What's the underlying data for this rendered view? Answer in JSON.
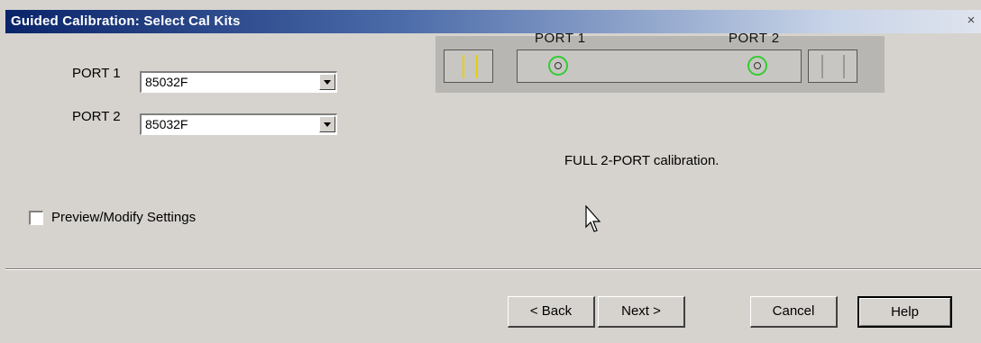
{
  "window": {
    "title": "Guided Calibration: Select Cal Kits",
    "close_glyph": "×"
  },
  "ports": [
    {
      "label": "PORT 1",
      "value": "85032F"
    },
    {
      "label": "PORT 2",
      "value": "85032F"
    }
  ],
  "diagram": {
    "port1_label": "PORT 1",
    "port2_label": "PORT 2"
  },
  "status": {
    "text": "FULL 2-PORT calibration."
  },
  "options": {
    "preview_label": "Preview/Modify Settings",
    "preview_checked": false
  },
  "buttons": {
    "back": "< Back",
    "next": "Next >",
    "cancel": "Cancel",
    "help": "Help"
  },
  "colors": {
    "title_start": "#0a246a",
    "connector_yellow": "#e8d000",
    "port_green": "#33cc33",
    "dialog_bg": "#d6d3ce"
  }
}
